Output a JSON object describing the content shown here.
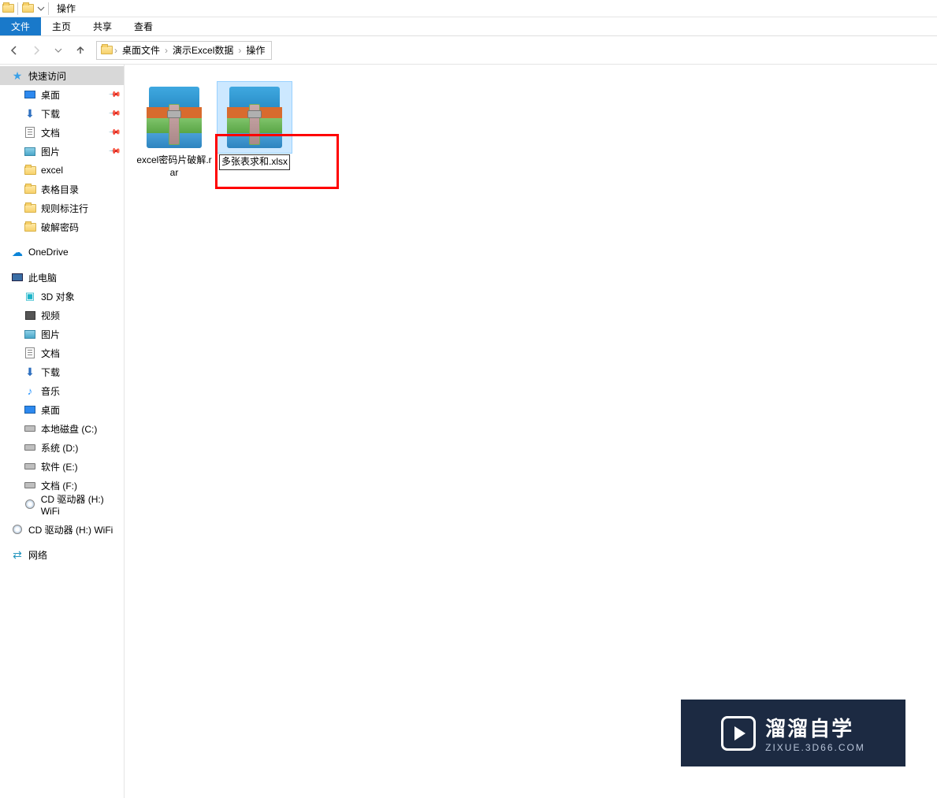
{
  "titlebar": {
    "title": "操作"
  },
  "ribbon": {
    "tabs": [
      "文件",
      "主页",
      "共享",
      "查看"
    ],
    "active_index": 0
  },
  "breadcrumb": {
    "segments": [
      "桌面文件",
      "演示Excel数据",
      "操作"
    ]
  },
  "sidebar": {
    "quick_access": {
      "header": "快速访问",
      "items": [
        {
          "label": "桌面",
          "icon": "desktop",
          "pinned": true
        },
        {
          "label": "下载",
          "icon": "download",
          "pinned": true
        },
        {
          "label": "文档",
          "icon": "doc",
          "pinned": true
        },
        {
          "label": "图片",
          "icon": "pic",
          "pinned": true
        },
        {
          "label": "excel",
          "icon": "folder",
          "pinned": false
        },
        {
          "label": "表格目录",
          "icon": "folder",
          "pinned": false
        },
        {
          "label": "规则标注行",
          "icon": "folder",
          "pinned": false
        },
        {
          "label": "破解密码",
          "icon": "folder",
          "pinned": false
        }
      ]
    },
    "onedrive": {
      "label": "OneDrive"
    },
    "this_pc": {
      "header": "此电脑",
      "items": [
        {
          "label": "3D 对象",
          "icon": "3d"
        },
        {
          "label": "视频",
          "icon": "video"
        },
        {
          "label": "图片",
          "icon": "pic"
        },
        {
          "label": "文档",
          "icon": "doc"
        },
        {
          "label": "下载",
          "icon": "download"
        },
        {
          "label": "音乐",
          "icon": "music"
        },
        {
          "label": "桌面",
          "icon": "desktop"
        },
        {
          "label": "本地磁盘 (C:)",
          "icon": "drive"
        },
        {
          "label": "系统 (D:)",
          "icon": "drive"
        },
        {
          "label": "软件 (E:)",
          "icon": "drive"
        },
        {
          "label": "文档 (F:)",
          "icon": "drive"
        },
        {
          "label": "CD 驱动器 (H:) WiFi",
          "icon": "cd"
        }
      ]
    },
    "cd_drive2": {
      "label": "CD 驱动器 (H:) WiFi"
    },
    "network": {
      "label": "网络"
    }
  },
  "files": [
    {
      "name": "excel密码片破解.rar",
      "selected": false,
      "editing": false
    },
    {
      "name": "多张表求和.xlsx",
      "selected": true,
      "editing": true
    }
  ],
  "watermark": {
    "title": "溜溜自学",
    "sub": "ZIXUE.3D66.COM"
  }
}
